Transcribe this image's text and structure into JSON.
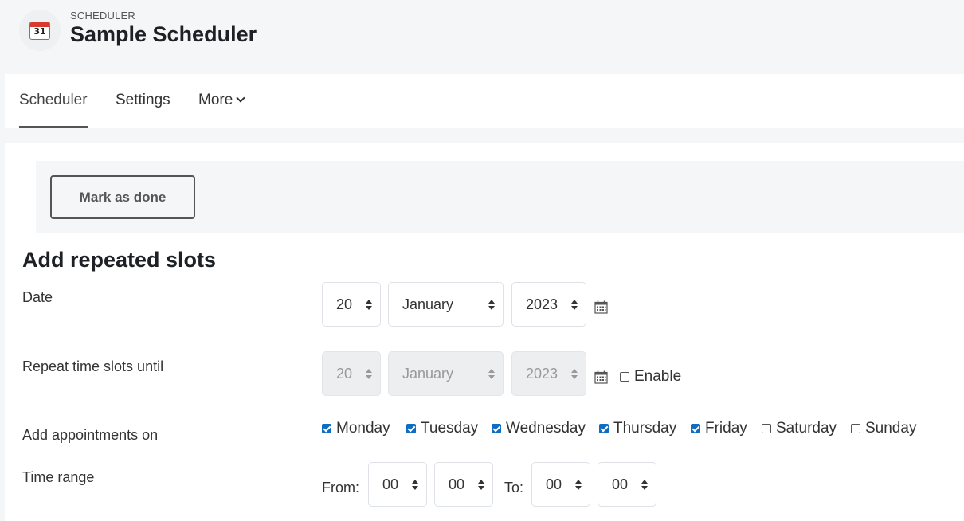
{
  "header": {
    "logo_text": "31",
    "kicker": "SCHEDULER",
    "title": "Sample Scheduler"
  },
  "nav": {
    "tabs": [
      {
        "label": "Scheduler",
        "active": true
      },
      {
        "label": "Settings",
        "active": false
      },
      {
        "label": "More",
        "active": false
      }
    ]
  },
  "activity": {
    "mark_done_label": "Mark as done"
  },
  "form": {
    "section_title": "Add repeated slots",
    "date": {
      "label": "Date",
      "day": "20",
      "month": "January",
      "year": "2023"
    },
    "repeat_until": {
      "label": "Repeat time slots until",
      "day": "20",
      "month": "January",
      "year": "2023",
      "enable_label": "Enable",
      "enabled": false
    },
    "days": {
      "label": "Add appointments on",
      "items": [
        {
          "label": "Monday",
          "checked": true
        },
        {
          "label": "Tuesday",
          "checked": true
        },
        {
          "label": "Wednesday",
          "checked": true
        },
        {
          "label": "Thursday",
          "checked": true
        },
        {
          "label": "Friday",
          "checked": true
        },
        {
          "label": "Saturday",
          "checked": false
        },
        {
          "label": "Sunday",
          "checked": false
        }
      ]
    },
    "time_range": {
      "label": "Time range",
      "from_label": "From:",
      "from_hour": "00",
      "from_minute": "00",
      "to_label": "To:",
      "to_hour": "00",
      "to_minute": "00"
    }
  },
  "colors": {
    "accent": "#0f6cbf",
    "page_bg": "#f5f6f7"
  }
}
